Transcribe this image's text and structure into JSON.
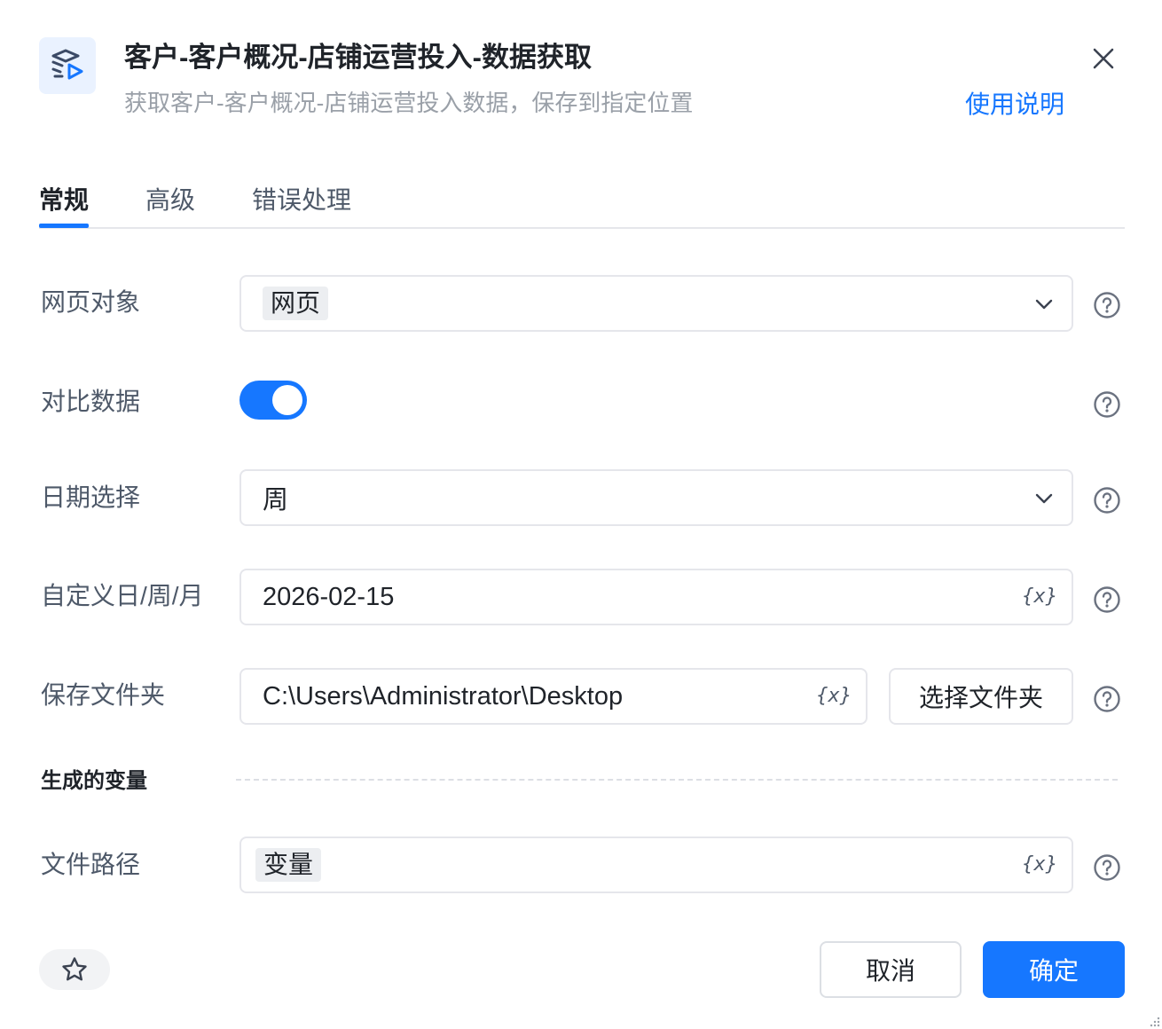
{
  "header": {
    "icon": "workflow-data-icon",
    "title": "客户-客户概况-店铺运营投入-数据获取",
    "subtitle": "获取客户-客户概况-店铺运营投入数据，保存到指定位置",
    "help_link": "使用说明"
  },
  "tabs": [
    {
      "label": "常规",
      "active": true
    },
    {
      "label": "高级",
      "active": false
    },
    {
      "label": "错误处理",
      "active": false
    }
  ],
  "form": {
    "web_object": {
      "label": "网页对象",
      "value": "网页"
    },
    "compare_data": {
      "label": "对比数据",
      "enabled": true
    },
    "date_select": {
      "label": "日期选择",
      "value": "周"
    },
    "custom_date": {
      "label": "自定义日/周/月",
      "value": "2026-02-15"
    },
    "save_folder": {
      "label": "保存文件夹",
      "value": "C:\\Users\\Administrator\\Desktop",
      "button": "选择文件夹"
    },
    "generated_vars_title": "生成的变量",
    "file_path": {
      "label": "文件路径",
      "value": "变量"
    }
  },
  "variable_icon_text": "{x}",
  "footer": {
    "cancel": "取消",
    "confirm": "确定"
  },
  "colors": {
    "accent": "#1677ff",
    "icon_bg": "#eaf2ff"
  }
}
